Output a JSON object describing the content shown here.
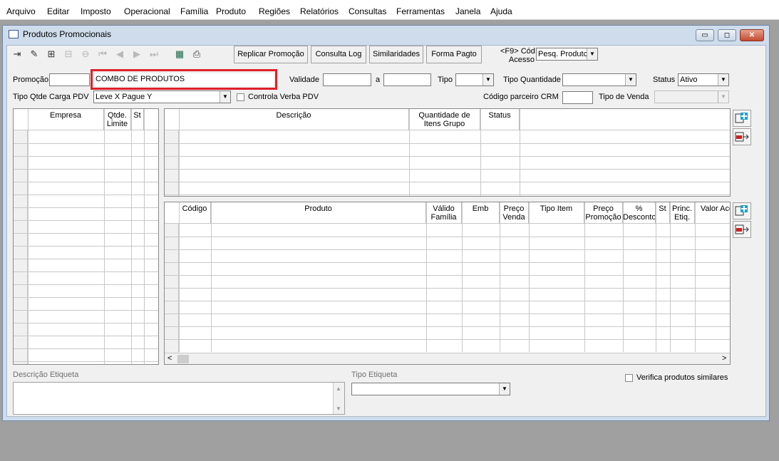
{
  "menu": [
    "Arquivo",
    "Editar",
    "Imposto",
    "Operacional",
    "Família",
    "Produto",
    "Regiões",
    "Relatórios",
    "Consultas",
    "Ferramentas",
    "Janela",
    "Ajuda"
  ],
  "window": {
    "title": "Produtos Promocionais"
  },
  "toolbar": {
    "buttons": [
      "Replicar Promoção",
      "Consulta Log",
      "Similaridades",
      "Forma Pagto"
    ],
    "f9_line1": "<F9> Cód",
    "f9_line2": "Acesso",
    "search_value": "Pesq. Produtc"
  },
  "form": {
    "promocao_label": "Promoção",
    "promocao_code": "",
    "promocao_desc": "COMBO DE PRODUTOS",
    "validade_label": "Validade",
    "a_label": "a",
    "tipo_label": "Tipo",
    "tipo_quantidade_label": "Tipo Quantidade",
    "status_label": "Status",
    "status_value": "Ativo",
    "tipo_qtde_carga_label": "Tipo Qtde Carga PDV",
    "tipo_qtde_carga_value": "Leve X Pague Y",
    "controla_verba_label": "Controla Verba PDV",
    "codigo_parceiro_label": "Código parceiro CRM",
    "tipo_venda_label": "Tipo de Venda"
  },
  "grid_empresa": {
    "headers": [
      "Empresa",
      "Qtde. Limite",
      "St"
    ]
  },
  "grid_grupo": {
    "headers": [
      "Descrição",
      "Quantidade de Itens Grupo",
      "Status"
    ]
  },
  "grid_produto": {
    "headers": [
      "Código",
      "Produto",
      "Válido Família",
      "Emb",
      "Preço Venda",
      "Tipo Item",
      "Preço Promoção",
      "% Desconto",
      "St",
      "Princ. Etiq.",
      "Valor Acordo"
    ]
  },
  "bottom": {
    "descricao_etiqueta_label": "Descrição Etiqueta",
    "tipo_etiqueta_label": "Tipo Etiqueta",
    "verifica_label": "Verifica produtos similares"
  },
  "colors": {
    "highlight": "#e0202a",
    "title_bar": "#cfdcec"
  }
}
